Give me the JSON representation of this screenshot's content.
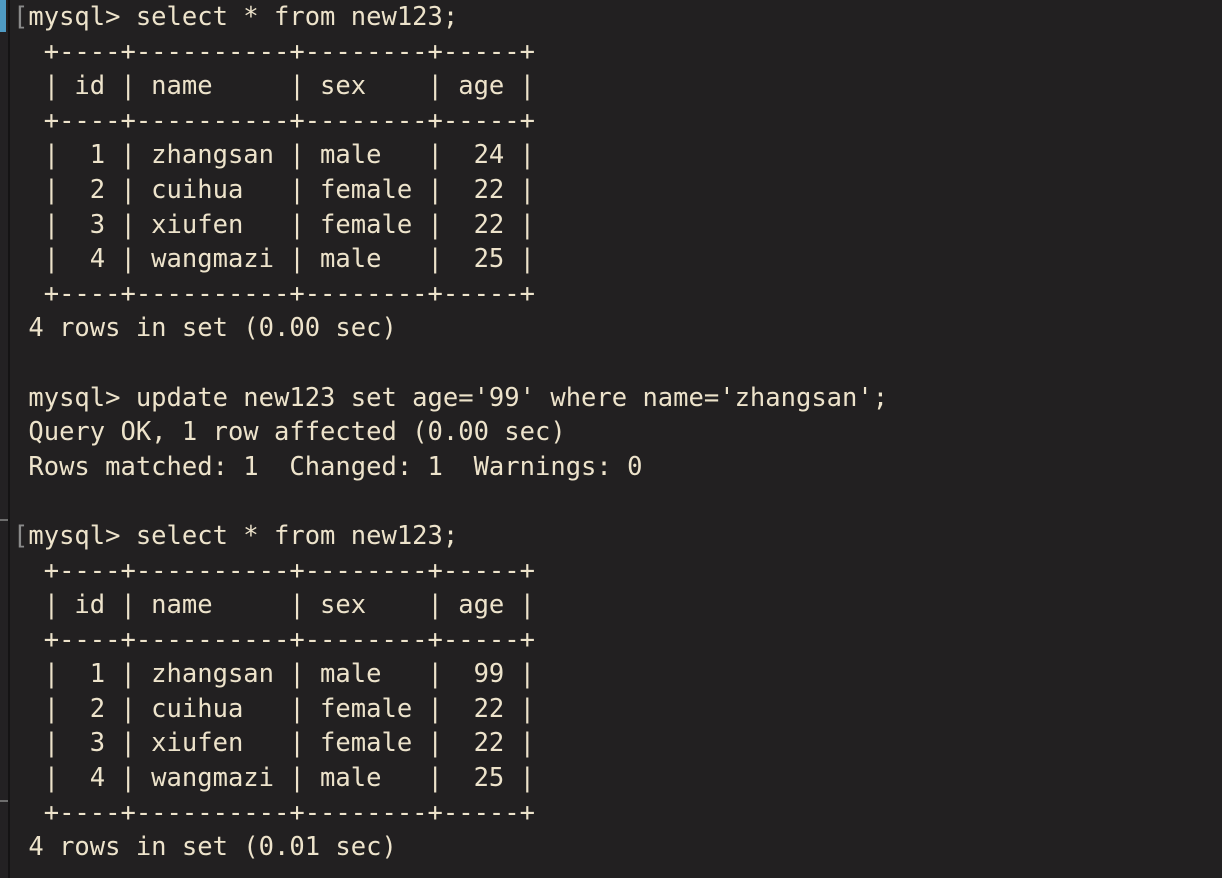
{
  "terminal": {
    "app": "mysql-client-terminal",
    "background_color": "#222021",
    "foreground_color": "#ede3cb",
    "marker_color": "#8a8a8a",
    "scrollbar_thumb_color": "#4f9bc4",
    "prompt": "mysql>",
    "line_marker": "["
  },
  "session": {
    "lines": [
      {
        "id": "l01",
        "kind": "prompt",
        "marker": "[",
        "text": "mysql> select * from new123;"
      },
      {
        "id": "l02",
        "kind": "rule",
        "marker": " ",
        "text": " +----+----------+--------+-----+"
      },
      {
        "id": "l03",
        "kind": "header",
        "marker": " ",
        "text": " | id | name     | sex    | age |"
      },
      {
        "id": "l04",
        "kind": "rule",
        "marker": " ",
        "text": " +----+----------+--------+-----+"
      },
      {
        "id": "l05",
        "kind": "row",
        "marker": " ",
        "text": " |  1 | zhangsan | male   |  24 |"
      },
      {
        "id": "l06",
        "kind": "row",
        "marker": " ",
        "text": " |  2 | cuihua   | female |  22 |"
      },
      {
        "id": "l07",
        "kind": "row",
        "marker": " ",
        "text": " |  3 | xiufen   | female |  22 |"
      },
      {
        "id": "l08",
        "kind": "row",
        "marker": " ",
        "text": " |  4 | wangmazi | male   |  25 |"
      },
      {
        "id": "l09",
        "kind": "rule",
        "marker": " ",
        "text": " +----+----------+--------+-----+"
      },
      {
        "id": "l10",
        "kind": "status",
        "marker": " ",
        "text": "4 rows in set (0.00 sec)"
      },
      {
        "id": "l11",
        "kind": "blank",
        "marker": " ",
        "text": ""
      },
      {
        "id": "l12",
        "kind": "prompt",
        "marker": " ",
        "text": "mysql> update new123 set age='99' where name='zhangsan';"
      },
      {
        "id": "l13",
        "kind": "status",
        "marker": " ",
        "text": "Query OK, 1 row affected (0.00 sec)"
      },
      {
        "id": "l14",
        "kind": "status",
        "marker": " ",
        "text": "Rows matched: 1  Changed: 1  Warnings: 0"
      },
      {
        "id": "l15",
        "kind": "blank",
        "marker": " ",
        "text": ""
      },
      {
        "id": "l16",
        "kind": "prompt",
        "marker": "[",
        "text": "mysql> select * from new123;"
      },
      {
        "id": "l17",
        "kind": "rule",
        "marker": " ",
        "text": " +----+----------+--------+-----+"
      },
      {
        "id": "l18",
        "kind": "header",
        "marker": " ",
        "text": " | id | name     | sex    | age |"
      },
      {
        "id": "l19",
        "kind": "rule",
        "marker": " ",
        "text": " +----+----------+--------+-----+"
      },
      {
        "id": "l20",
        "kind": "row",
        "marker": " ",
        "text": " |  1 | zhangsan | male   |  99 |"
      },
      {
        "id": "l21",
        "kind": "row",
        "marker": " ",
        "text": " |  2 | cuihua   | female |  22 |"
      },
      {
        "id": "l22",
        "kind": "row",
        "marker": " ",
        "text": " |  3 | xiufen   | female |  22 |"
      },
      {
        "id": "l23",
        "kind": "row",
        "marker": " ",
        "text": " |  4 | wangmazi | male   |  25 |"
      },
      {
        "id": "l24",
        "kind": "rule",
        "marker": " ",
        "text": " +----+----------+--------+-----+"
      },
      {
        "id": "l25",
        "kind": "status",
        "marker": " ",
        "text": "4 rows in set (0.01 sec)"
      }
    ]
  },
  "queries": [
    {
      "id": "q1",
      "sql": "select * from new123;",
      "result_status": "4 rows in set (0.00 sec)"
    },
    {
      "id": "q2",
      "sql": "update new123 set age='99' where name='zhangsan';",
      "result_status": "Query OK, 1 row affected (0.00 sec)",
      "result_detail": "Rows matched: 1  Changed: 1  Warnings: 0"
    },
    {
      "id": "q3",
      "sql": "select * from new123;",
      "result_status": "4 rows in set (0.01 sec)"
    }
  ],
  "result_tables": [
    {
      "id": "table-before",
      "name": "new123",
      "columns": [
        "id",
        "name",
        "sex",
        "age"
      ],
      "rows": [
        [
          "1",
          "zhangsan",
          "male",
          "24"
        ],
        [
          "2",
          "cuihua",
          "female",
          "22"
        ],
        [
          "3",
          "xiufen",
          "female",
          "22"
        ],
        [
          "4",
          "wangmazi",
          "male",
          "25"
        ]
      ],
      "row_count": 4,
      "elapsed": "0.00 sec"
    },
    {
      "id": "table-after",
      "name": "new123",
      "columns": [
        "id",
        "name",
        "sex",
        "age"
      ],
      "rows": [
        [
          "1",
          "zhangsan",
          "male",
          "99"
        ],
        [
          "2",
          "cuihua",
          "female",
          "22"
        ],
        [
          "3",
          "xiufen",
          "female",
          "22"
        ],
        [
          "4",
          "wangmazi",
          "male",
          "25"
        ]
      ],
      "row_count": 4,
      "elapsed": "0.01 sec"
    }
  ]
}
